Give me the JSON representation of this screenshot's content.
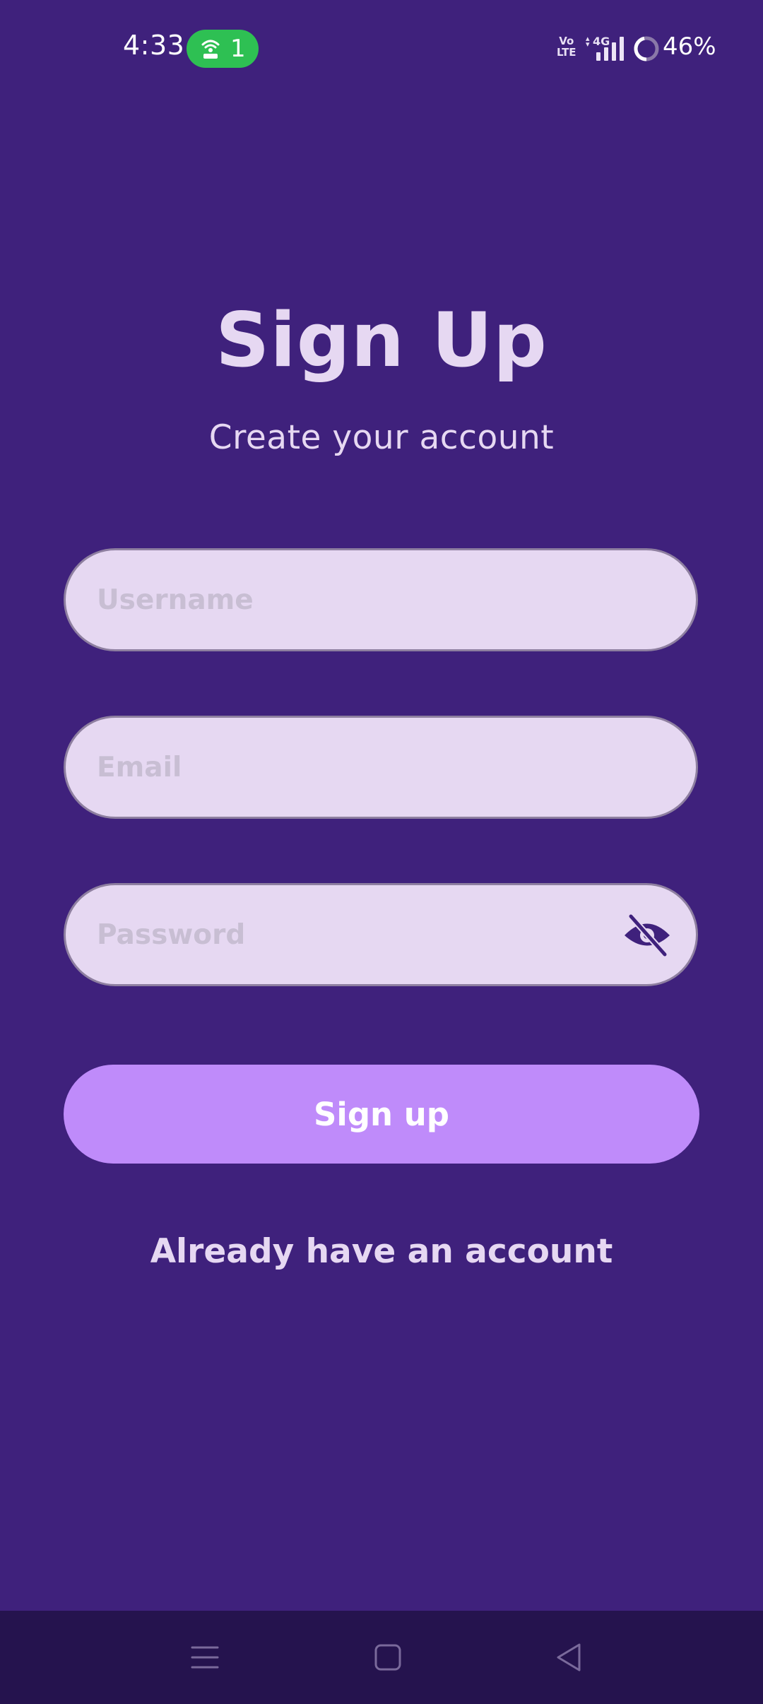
{
  "status_bar": {
    "time": "4:33",
    "hotspot_count": "1",
    "volte_top": "Vo",
    "volte_bottom": "LTE",
    "network": "4G",
    "battery": "46%"
  },
  "header": {
    "title": "Sign Up",
    "subtitle": "Create your account"
  },
  "form": {
    "username_placeholder": "Username",
    "email_placeholder": "Email",
    "password_placeholder": "Password",
    "submit_label": "Sign up",
    "login_link": "Already have an account"
  },
  "icons": {
    "hotspot": "hotspot-icon",
    "signal": "signal-bars-icon",
    "battery": "battery-ring-icon",
    "password_toggle": "eye-slash-icon",
    "nav_menu": "menu-icon",
    "nav_home": "home-square-icon",
    "nav_back": "back-triangle-icon"
  },
  "colors": {
    "background": "#3f217c",
    "field_background": "#e6d8f2",
    "button": "#bf8bfa",
    "hotspot_pill": "#2ec053",
    "nav_bar": "#25134e"
  }
}
